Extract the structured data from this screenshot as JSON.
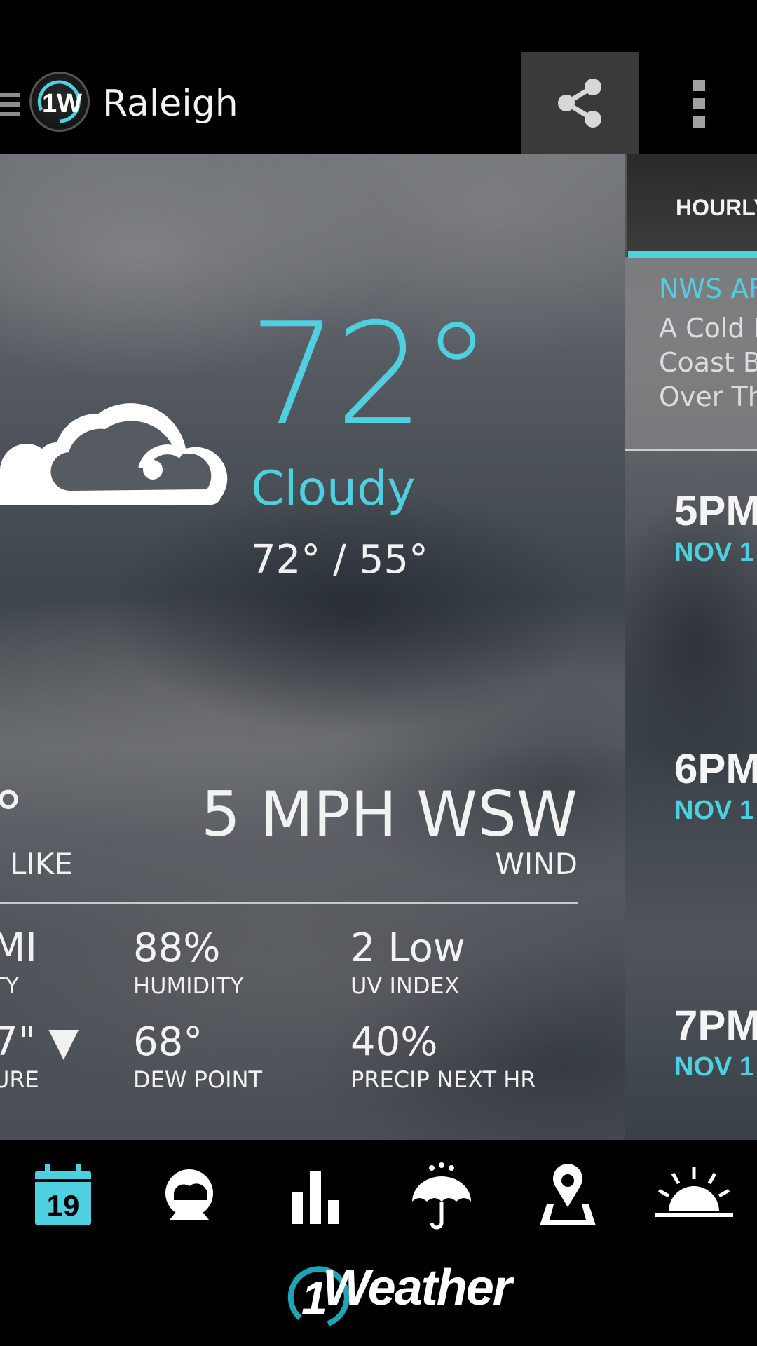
{
  "header": {
    "city": "Raleigh",
    "logo_text": "1W"
  },
  "current": {
    "temperature": "72°",
    "condition": "Cloudy",
    "high_low": "72° / 55°",
    "feels_like_value": "°",
    "feels_like_label": "S LIKE",
    "wind_value": "5 MPH WSW",
    "wind_label": "WIND"
  },
  "details": [
    {
      "value": "MI",
      "label": "TY"
    },
    {
      "value": "88%",
      "label": "HUMIDITY"
    },
    {
      "value": "2 Low",
      "label": "UV INDEX"
    },
    {
      "value": "7\" ▼",
      "label": "URE"
    },
    {
      "value": "68°",
      "label": "DEW POINT"
    },
    {
      "value": "40%",
      "label": "PRECIP NEXT HR"
    }
  ],
  "hourly": {
    "tab_label": "HOURLY",
    "alert_title": "NWS AF",
    "alert_text": "A Cold F\nCoast B\nOver Th",
    "items": [
      {
        "time": "5PM",
        "date": "NOV 1"
      },
      {
        "time": "6PM",
        "date": "NOV 1"
      },
      {
        "time": "7PM",
        "date": "NOV 1"
      }
    ]
  },
  "nav": {
    "calendar_day": "19",
    "icons": [
      "calendar-icon",
      "radar-globe-icon",
      "graph-icon",
      "precip-umbrella-icon",
      "map-pin-icon",
      "sunrise-icon"
    ]
  },
  "brand": {
    "name": "Weather",
    "mark": "1"
  },
  "colors": {
    "accent": "#4fd0e0",
    "background": "#000000"
  }
}
